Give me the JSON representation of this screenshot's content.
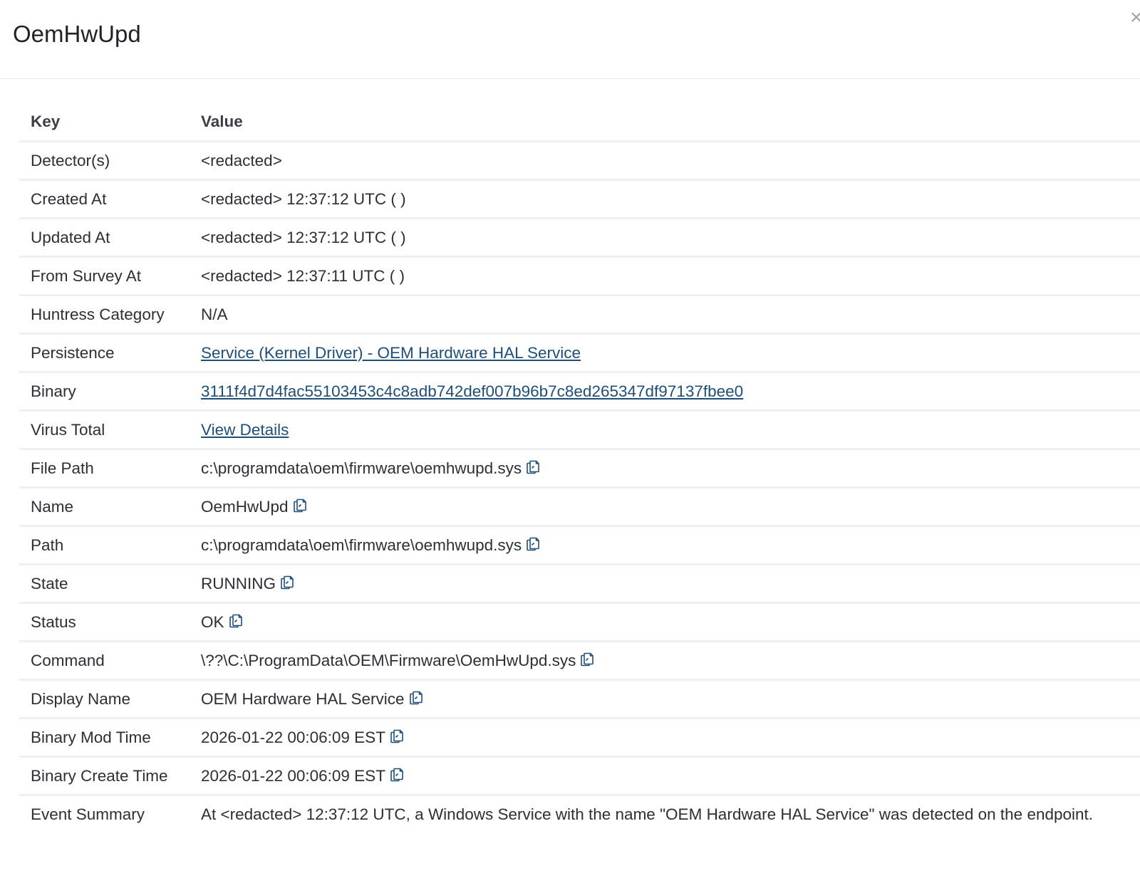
{
  "modal": {
    "title": "OemHwUpd",
    "close_icon": "close-icon"
  },
  "table": {
    "headers": {
      "key": "Key",
      "value": "Value"
    },
    "rows": [
      {
        "key": "Detector(s)",
        "value": "<redacted>",
        "type": "text"
      },
      {
        "key": "Created At",
        "value": "<redacted> 12:37:12 UTC ( )",
        "type": "text"
      },
      {
        "key": "Updated At",
        "value": "<redacted> 12:37:12 UTC ( )",
        "type": "text"
      },
      {
        "key": "From Survey At",
        "value": "<redacted> 12:37:11 UTC ( )",
        "type": "text"
      },
      {
        "key": "Huntress Category",
        "value": "N/A",
        "type": "text"
      },
      {
        "key": "Persistence",
        "value": "Service (Kernel Driver) - OEM Hardware HAL Service",
        "type": "link"
      },
      {
        "key": "Binary",
        "value": "3111f4d7d4fac55103453c4c8adb742def007b96b7c8ed265347df97137fbee0",
        "type": "link"
      },
      {
        "key": "Virus Total",
        "value": "View Details",
        "type": "link"
      },
      {
        "key": "File Path",
        "value": "c:\\programdata\\oem\\firmware\\oemhwupd.sys",
        "type": "copy"
      },
      {
        "key": "Name",
        "value": "OemHwUpd",
        "type": "copy"
      },
      {
        "key": "Path",
        "value": "c:\\programdata\\oem\\firmware\\oemhwupd.sys",
        "type": "copy"
      },
      {
        "key": "State",
        "value": "RUNNING",
        "type": "copy"
      },
      {
        "key": "Status",
        "value": "OK",
        "type": "copy"
      },
      {
        "key": "Command",
        "value": "\\??\\C:\\ProgramData\\OEM\\Firmware\\OemHwUpd.sys",
        "type": "copy"
      },
      {
        "key": "Display Name",
        "value": "OEM Hardware HAL Service",
        "type": "copy"
      },
      {
        "key": "Binary Mod Time",
        "value": "2026-01-22 00:06:09 EST",
        "type": "copy"
      },
      {
        "key": "Binary Create Time",
        "value": "2026-01-22 00:06:09 EST",
        "type": "copy"
      },
      {
        "key": "Event Summary",
        "value": "At <redacted> 12:37:12 UTC, a Windows Service with the name \"OEM Hardware HAL Service\" was detected on the endpoint.",
        "type": "text"
      }
    ]
  },
  "colors": {
    "link": "#1f4e79",
    "row_border": "#eef0f2",
    "text": "#2b2f36"
  },
  "icons": {
    "copy": "copy-icon",
    "close": "close-icon"
  }
}
